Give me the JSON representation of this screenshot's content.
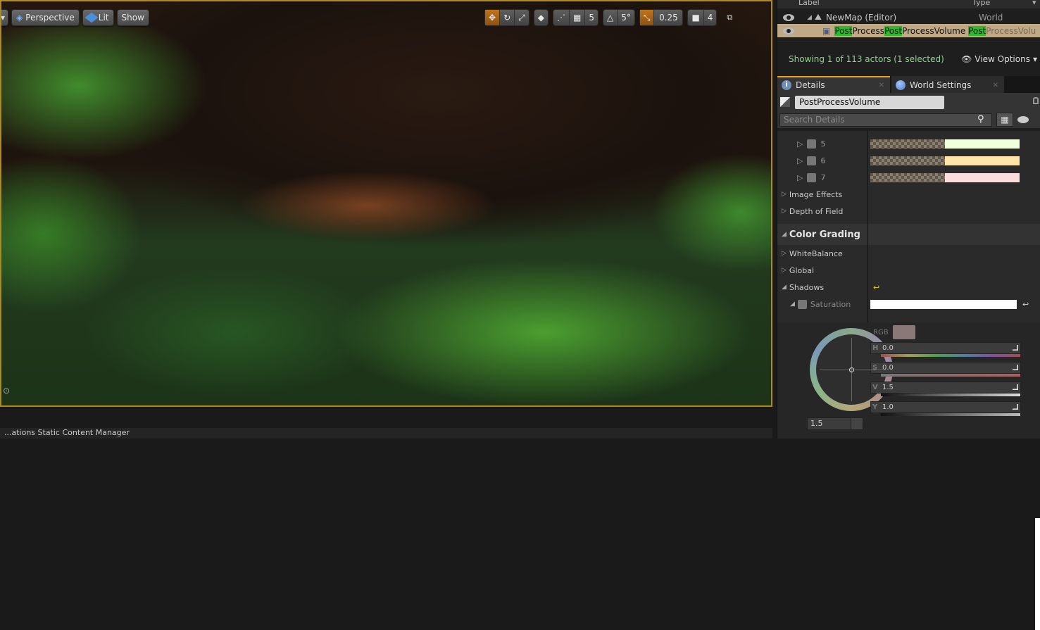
{
  "viewport": {
    "perspective_label": "Perspective",
    "lit_label": "Lit",
    "show_label": "Show",
    "grid_snap_value": "5",
    "rotation_snap_value": "5°",
    "scale_snap_value": "0.25",
    "camera_speed_value": "4"
  },
  "bottom": {
    "text": "...ations  Static  Content  Manager"
  },
  "outliner": {
    "col_label": "Label",
    "col_type": "Type",
    "rows": [
      {
        "label": "NewMap (Editor)",
        "type": "World"
      },
      {
        "label_parts": [
          "Post",
          "Process",
          "Post",
          "ProcessVolume ",
          "Post",
          "ProcessVolu"
        ],
        "type": "PostProcessVolume"
      }
    ],
    "status_text": "Showing 1 of 113 actors (1 selected)",
    "view_options_label": "View Options"
  },
  "details": {
    "tabs": [
      {
        "label": "Details"
      },
      {
        "label": "World Settings"
      }
    ],
    "object_name": "PostProcessVolume",
    "search_placeholder": "Search Details",
    "indexed_rows": [
      {
        "index": "5",
        "color": "#f2ffdc"
      },
      {
        "index": "6",
        "color": "#ffe6a8"
      },
      {
        "index": "7",
        "color": "#fbdcdc"
      }
    ],
    "sections": {
      "image_effects": "Image Effects",
      "depth_of_field": "Depth of Field",
      "color_grading": "Color Grading",
      "white_balance": "WhiteBalance",
      "global": "Global",
      "shadows": "Shadows",
      "saturation": "Saturation"
    },
    "picker": {
      "rgb_label": "RGB",
      "wheel_value": "1.5",
      "sliders": [
        {
          "label": "H",
          "value": "0.0"
        },
        {
          "label": "S",
          "value": "0.0"
        },
        {
          "label": "V",
          "value": "1.5"
        },
        {
          "label": "Y",
          "value": "1.0"
        }
      ]
    }
  }
}
